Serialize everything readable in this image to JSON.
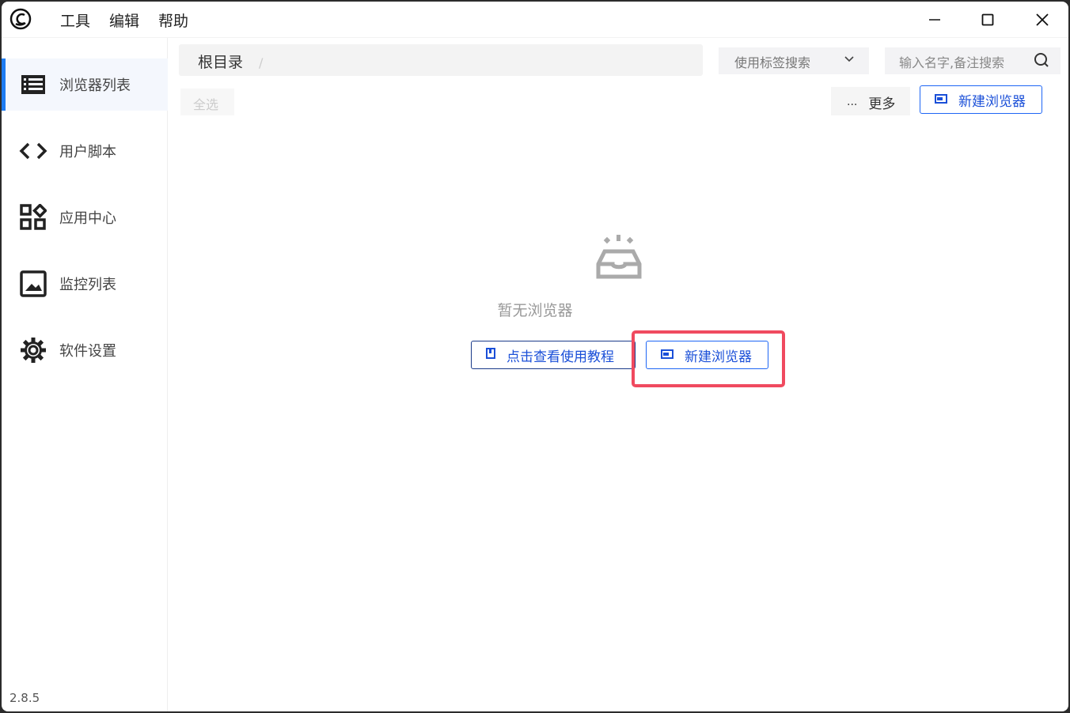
{
  "menu": [
    "工具",
    "编辑",
    "帮助"
  ],
  "sidebar": {
    "items": [
      {
        "label": "浏览器列表",
        "icon": "list-icon"
      },
      {
        "label": "用户脚本",
        "icon": "code-icon"
      },
      {
        "label": "应用中心",
        "icon": "apps-icon"
      },
      {
        "label": "监控列表",
        "icon": "image-icon"
      },
      {
        "label": "软件设置",
        "icon": "gear-icon"
      }
    ],
    "version": "2.8.5"
  },
  "breadcrumb": {
    "root": "根目录",
    "sep": "/"
  },
  "toolbar": {
    "tag_search": "使用标签搜索",
    "search_placeholder": "输入名字,备注搜索",
    "select_all": "全选",
    "more": "更多",
    "new_browser": "新建浏览器"
  },
  "empty": {
    "text": "暂无浏览器",
    "tutorial": "点击查看使用教程",
    "new_browser": "新建浏览器"
  },
  "colors": {
    "accent": "#1e66f5",
    "highlight": "#f04a5f"
  }
}
